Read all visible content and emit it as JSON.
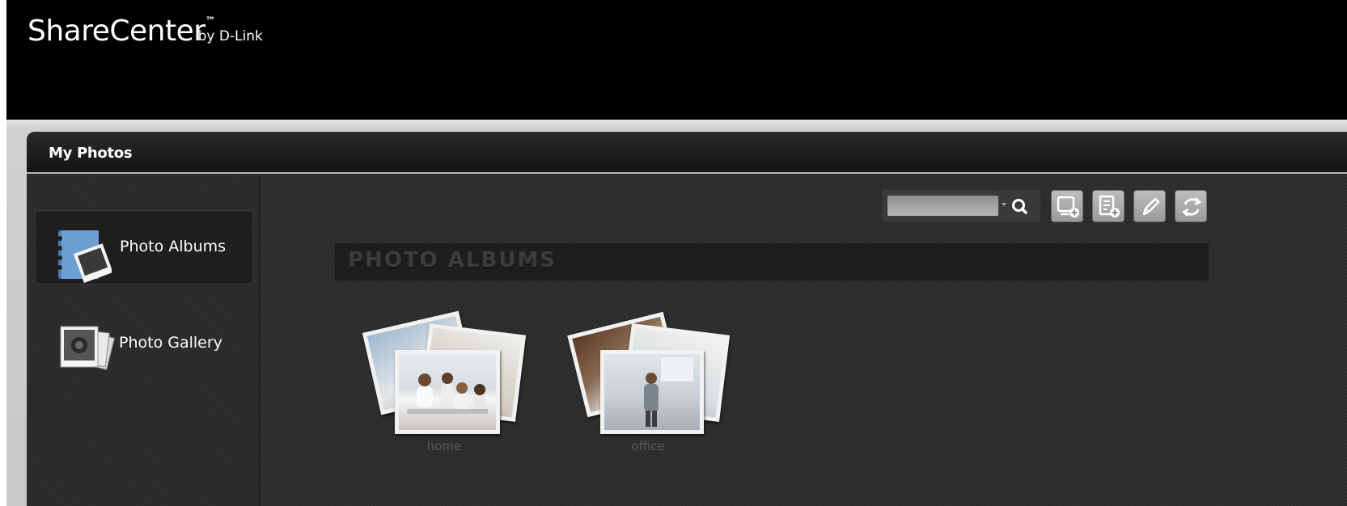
{
  "app": {
    "brand": "ShareCenter",
    "trademark": "™",
    "byline": "by D-Link"
  },
  "panel": {
    "title": "My Photos"
  },
  "sidebar": {
    "items": [
      {
        "label": "Photo Albums",
        "icon": "photo-albums-icon",
        "active": true
      },
      {
        "label": "Photo Gallery",
        "icon": "photo-gallery-icon",
        "active": false
      }
    ]
  },
  "toolbar": {
    "search_value": "",
    "search_icon": "search-icon",
    "buttons": [
      {
        "icon": "add-album-icon"
      },
      {
        "icon": "add-photo-icon"
      },
      {
        "icon": "edit-icon"
      },
      {
        "icon": "refresh-icon"
      }
    ]
  },
  "section": {
    "title": "PHOTO ALBUMS"
  },
  "albums": [
    {
      "name": "home"
    },
    {
      "name": "office"
    }
  ],
  "colors": {
    "header": "#000000",
    "panel": "#262626",
    "accent_border": "#b8b8b8"
  }
}
